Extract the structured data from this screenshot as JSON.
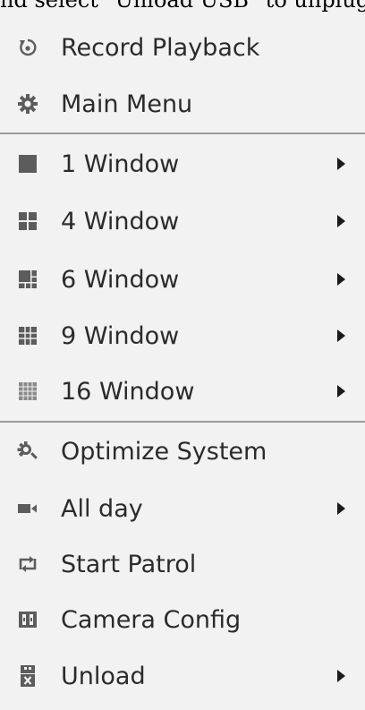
{
  "caption": "nd select \"Unload USB\" to unplug",
  "menu": {
    "items": [
      {
        "label": "Record Playback",
        "icon": "record-playback-icon",
        "submenu": false
      },
      {
        "label": "Main Menu",
        "icon": "gear-icon",
        "submenu": false
      },
      {
        "label": "1 Window",
        "icon": "single-window-icon",
        "submenu": true
      },
      {
        "label": "4 Window",
        "icon": "four-window-icon",
        "submenu": true
      },
      {
        "label": "6 Window",
        "icon": "six-window-icon",
        "submenu": true
      },
      {
        "label": "9 Window",
        "icon": "nine-window-icon",
        "submenu": true
      },
      {
        "label": "16 Window",
        "icon": "sixteen-window-icon",
        "submenu": true
      },
      {
        "label": "Optimize System",
        "icon": "optimize-icon",
        "submenu": false
      },
      {
        "label": "All day",
        "icon": "video-camera-icon",
        "submenu": true
      },
      {
        "label": "Start Patrol",
        "icon": "patrol-cycle-icon",
        "submenu": false
      },
      {
        "label": "Camera Config",
        "icon": "camera-config-icon",
        "submenu": false
      },
      {
        "label": "Unload",
        "icon": "usb-unload-icon",
        "submenu": true
      }
    ]
  },
  "colors": {
    "background": "#f2f2f2",
    "text": "#2b2b2b",
    "icon": "#6a6a6a",
    "divider": "#9a9a9a"
  }
}
